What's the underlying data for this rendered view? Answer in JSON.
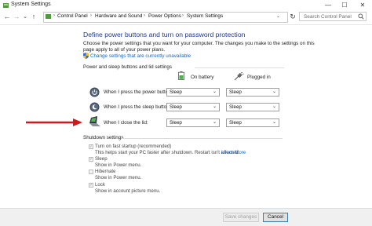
{
  "window": {
    "title": "System Settings",
    "minimize": "—",
    "maximize": "☐",
    "close": "✕"
  },
  "nav": {
    "back": "←",
    "forward": "→",
    "recent": "⌄",
    "up": "↑",
    "breadcrumb": [
      "Control Panel",
      "Hardware and Sound",
      "Power Options",
      "System Settings"
    ],
    "refresh": "↻",
    "search_placeholder": "Search Control Panel"
  },
  "page": {
    "heading": "Define power buttons and turn on password protection",
    "intro": "Choose the power settings that you want for your computer. The changes you make to the settings on this page apply to all of your power plans.",
    "change_link": "Change settings that are currently unavailable"
  },
  "power_section": {
    "title": "Power and sleep buttons and lid settings",
    "col_battery": "On battery",
    "col_plugged": "Plugged in",
    "rows": [
      {
        "label": "When I press the power button:",
        "battery": "Sleep",
        "plugged": "Sleep"
      },
      {
        "label": "When I press the sleep button:",
        "battery": "Sleep",
        "plugged": "Sleep"
      },
      {
        "label": "When I close the lid:",
        "battery": "Sleep",
        "plugged": "Sleep"
      }
    ]
  },
  "shutdown_section": {
    "title": "Shutdown settings",
    "items": [
      {
        "label": "Turn on fast startup (recommended)",
        "desc": "This helps start your PC faster after shutdown. Restart isn't affected.",
        "learn_more": "Learn More",
        "checked": true
      },
      {
        "label": "Sleep",
        "desc": "Show in Power menu.",
        "checked": true
      },
      {
        "label": "Hibernate",
        "desc": "Show in Power menu.",
        "checked": false
      },
      {
        "label": "Lock",
        "desc": "Show in account picture menu.",
        "checked": true
      }
    ]
  },
  "footer": {
    "save": "Save changes",
    "cancel": "Cancel"
  },
  "colors": {
    "heading": "#1e3a8a",
    "link": "#1565c0",
    "arrow": "#d0191c"
  }
}
